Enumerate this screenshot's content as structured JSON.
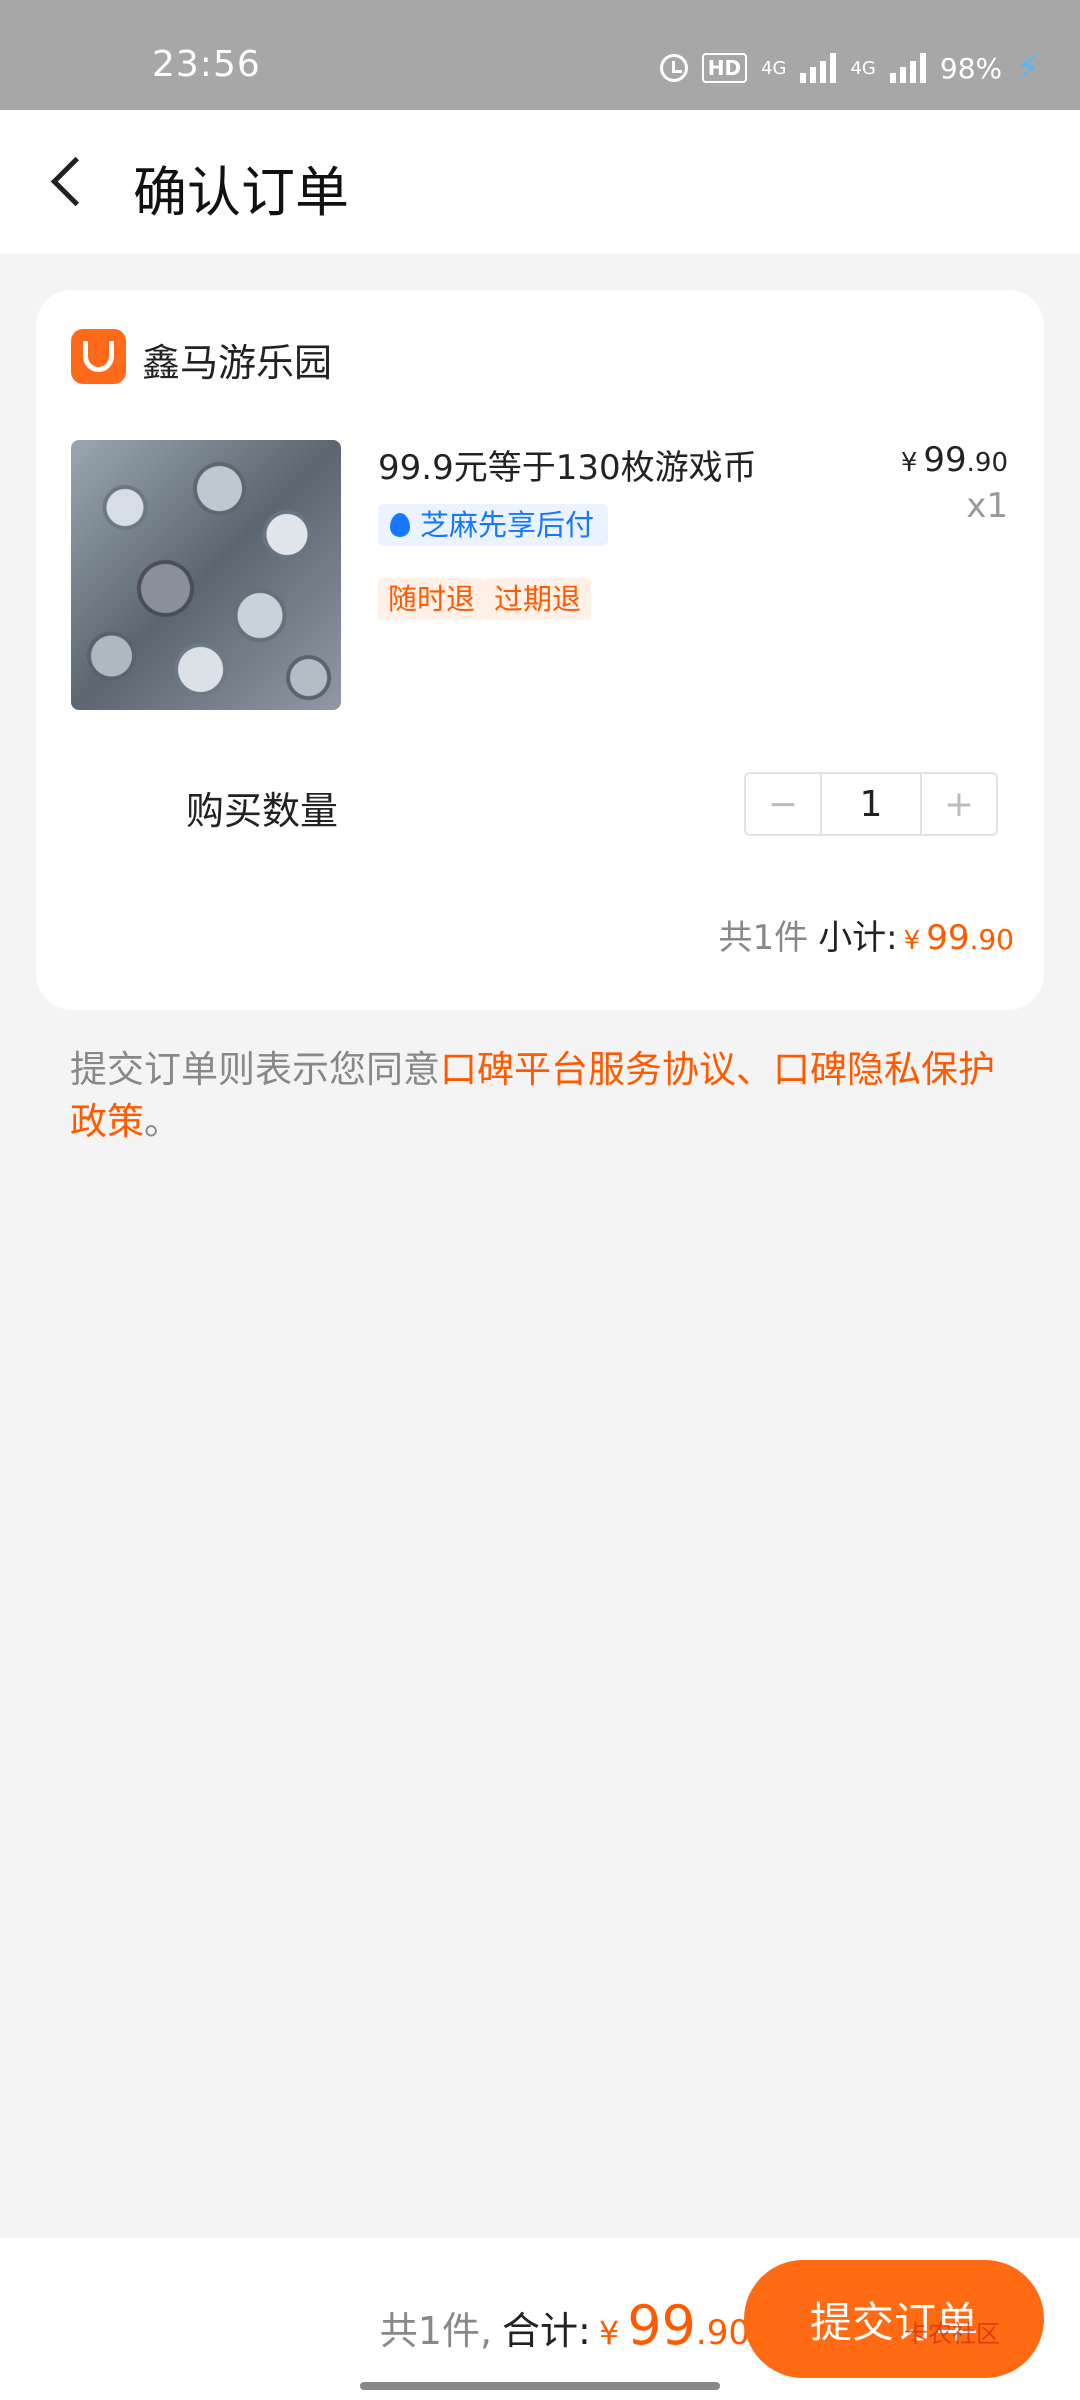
{
  "status_bar": {
    "time": "23:56",
    "hd": "HD",
    "net1": "4G",
    "net2": "4G",
    "battery": "98%",
    "icons": [
      "alarm-icon",
      "hd-icon",
      "signal-icon",
      "signal-icon",
      "charging-icon"
    ]
  },
  "header": {
    "title": "确认订单"
  },
  "store": {
    "name": "鑫马游乐园"
  },
  "product": {
    "title": "99.9元等于130枚游戏币",
    "price_currency": "¥",
    "price_int": "99",
    "price_dec": ".90",
    "quantity_label": "x1",
    "zhima_badge": "芝麻先享后付",
    "tags": [
      "随时退",
      "过期退"
    ]
  },
  "quantity": {
    "label": "购买数量",
    "minus": "−",
    "value": "1",
    "plus": "+"
  },
  "subtotal": {
    "count": "共1件",
    "label": "小计:",
    "currency": "¥",
    "int": "99",
    "dec": ".90"
  },
  "agreement": {
    "prefix": "提交订单则表示您同意",
    "link": "口碑平台服务协议、口碑隐私保护政策",
    "suffix": "。"
  },
  "bottom_bar": {
    "count": "共1件,",
    "label": "合计:",
    "currency": "¥",
    "int": "99",
    "dec": ".90",
    "submit_label": "提交订单",
    "watermark": "卡农社区"
  },
  "colors": {
    "accent": "#ff6a13",
    "price": "#ff5a00",
    "zhima_blue": "#1677ff"
  }
}
